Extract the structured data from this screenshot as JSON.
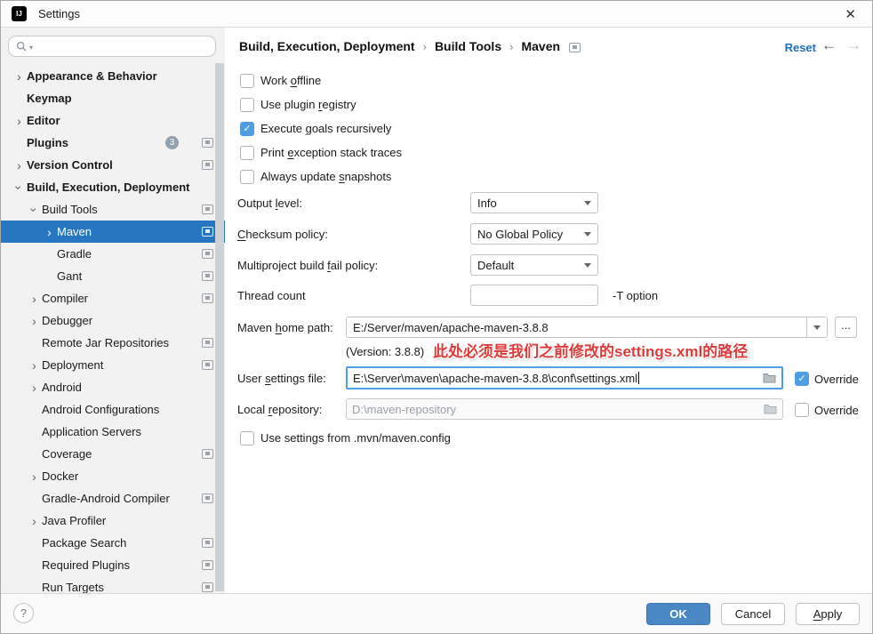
{
  "window": {
    "title": "Settings",
    "logo_text": "IJ"
  },
  "icons": {
    "close": "✕",
    "chevron": "›",
    "caret_down": "▾",
    "back_arrow": "←",
    "forward_arrow": "→",
    "ellipsis": "...",
    "check": "✓",
    "help": "?",
    "search": "magnifier",
    "folder": "folder",
    "dropdown_arrow": "triangle-down",
    "settings_page": "screen-square"
  },
  "colors": {
    "selection_blue": "#2776c2",
    "checkbox_blue": "#4f9ee3",
    "focus_border": "#4d9ee8",
    "ok_button": "#4a87c5",
    "link_blue": "#1d6fc2",
    "annotation_red": "#e03b3b",
    "sidebar_bg": "#f2f2f2"
  },
  "sidebar": {
    "search_placeholder": "",
    "items": [
      {
        "label": "Appearance & Behavior",
        "level": 0,
        "bold": true,
        "chevron": "right"
      },
      {
        "label": "Keymap",
        "level": 0,
        "bold": true
      },
      {
        "label": "Editor",
        "level": 0,
        "bold": true,
        "chevron": "right"
      },
      {
        "label": "Plugins",
        "level": 0,
        "bold": true,
        "badge": "3",
        "icon": true
      },
      {
        "label": "Version Control",
        "level": 0,
        "bold": true,
        "chevron": "right",
        "icon": true
      },
      {
        "label": "Build, Execution, Deployment",
        "level": 0,
        "bold": true,
        "chevron": "down"
      },
      {
        "label": "Build Tools",
        "level": 1,
        "chevron": "down",
        "icon": true
      },
      {
        "label": "Maven",
        "level": 2,
        "chevron": "right",
        "icon": true,
        "selected": true
      },
      {
        "label": "Gradle",
        "level": 2,
        "icon": true
      },
      {
        "label": "Gant",
        "level": 2,
        "icon": true
      },
      {
        "label": "Compiler",
        "level": 1,
        "chevron": "right",
        "icon": true
      },
      {
        "label": "Debugger",
        "level": 1,
        "chevron": "right"
      },
      {
        "label": "Remote Jar Repositories",
        "level": 1,
        "icon": true
      },
      {
        "label": "Deployment",
        "level": 1,
        "chevron": "right",
        "icon": true
      },
      {
        "label": "Android",
        "level": 1,
        "chevron": "right"
      },
      {
        "label": "Android Configurations",
        "level": 1
      },
      {
        "label": "Application Servers",
        "level": 1
      },
      {
        "label": "Coverage",
        "level": 1,
        "icon": true
      },
      {
        "label": "Docker",
        "level": 1,
        "chevron": "right"
      },
      {
        "label": "Gradle-Android Compiler",
        "level": 1,
        "icon": true
      },
      {
        "label": "Java Profiler",
        "level": 1,
        "chevron": "right"
      },
      {
        "label": "Package Search",
        "level": 1,
        "icon": true
      },
      {
        "label": "Required Plugins",
        "level": 1,
        "icon": true
      },
      {
        "label": "Run Targets",
        "level": 1,
        "icon": true
      }
    ]
  },
  "breadcrumb": {
    "parts": [
      "Build, Execution, Deployment",
      "Build Tools",
      "Maven"
    ],
    "separator": "›"
  },
  "header": {
    "reset_label": "Reset"
  },
  "form": {
    "checkboxes": [
      {
        "pre": "Work ",
        "m": "o",
        "post": "ffline",
        "checked": false
      },
      {
        "pre": "Use plugin ",
        "m": "r",
        "post": "egistry",
        "checked": false
      },
      {
        "pre": "Execute ",
        "m": "g",
        "post": "oals recursively",
        "checked": true
      },
      {
        "pre": "Print ",
        "m": "e",
        "post": "xception stack traces",
        "checked": false
      },
      {
        "pre": "Always update ",
        "m": "s",
        "post": "napshots",
        "checked": false
      }
    ],
    "selects": [
      {
        "label_pre": "Output ",
        "label_m": "l",
        "label_post": "evel:",
        "value": "Info"
      },
      {
        "label_pre": "",
        "label_m": "C",
        "label_post": "hecksum policy:",
        "value": "No Global Policy"
      },
      {
        "label_pre": "Multiproject build ",
        "label_m": "f",
        "label_post": "ail policy:",
        "value": "Default"
      }
    ],
    "thread": {
      "label": "Thread count",
      "value": "",
      "suffix": "-T option"
    },
    "maven_home": {
      "label_pre": "Maven ",
      "label_m": "h",
      "label_post": "ome path:",
      "value": "E:/Server/maven/apache-maven-3.8.8"
    },
    "version_note": "(Version: 3.8.8)",
    "annotation": "此处必须是我们之前修改的settings.xml的路径",
    "user_settings": {
      "label_pre": "User ",
      "label_m": "s",
      "label_post": "ettings file:",
      "value": "E:\\Server\\maven\\apache-maven-3.8.8\\conf\\settings.xml",
      "override_label": "Override",
      "override_checked": true
    },
    "local_repository": {
      "label_pre": "Local ",
      "label_m": "r",
      "label_post": "epository:",
      "value": "D:\\maven-repository",
      "override_label": "Override",
      "override_checked": false
    },
    "mvn_config": {
      "label": "Use settings from .mvn/maven.config",
      "checked": false
    }
  },
  "footer": {
    "ok": "OK",
    "cancel": "Cancel",
    "apply_m": "A",
    "apply_post": "pply",
    "help": "?"
  }
}
